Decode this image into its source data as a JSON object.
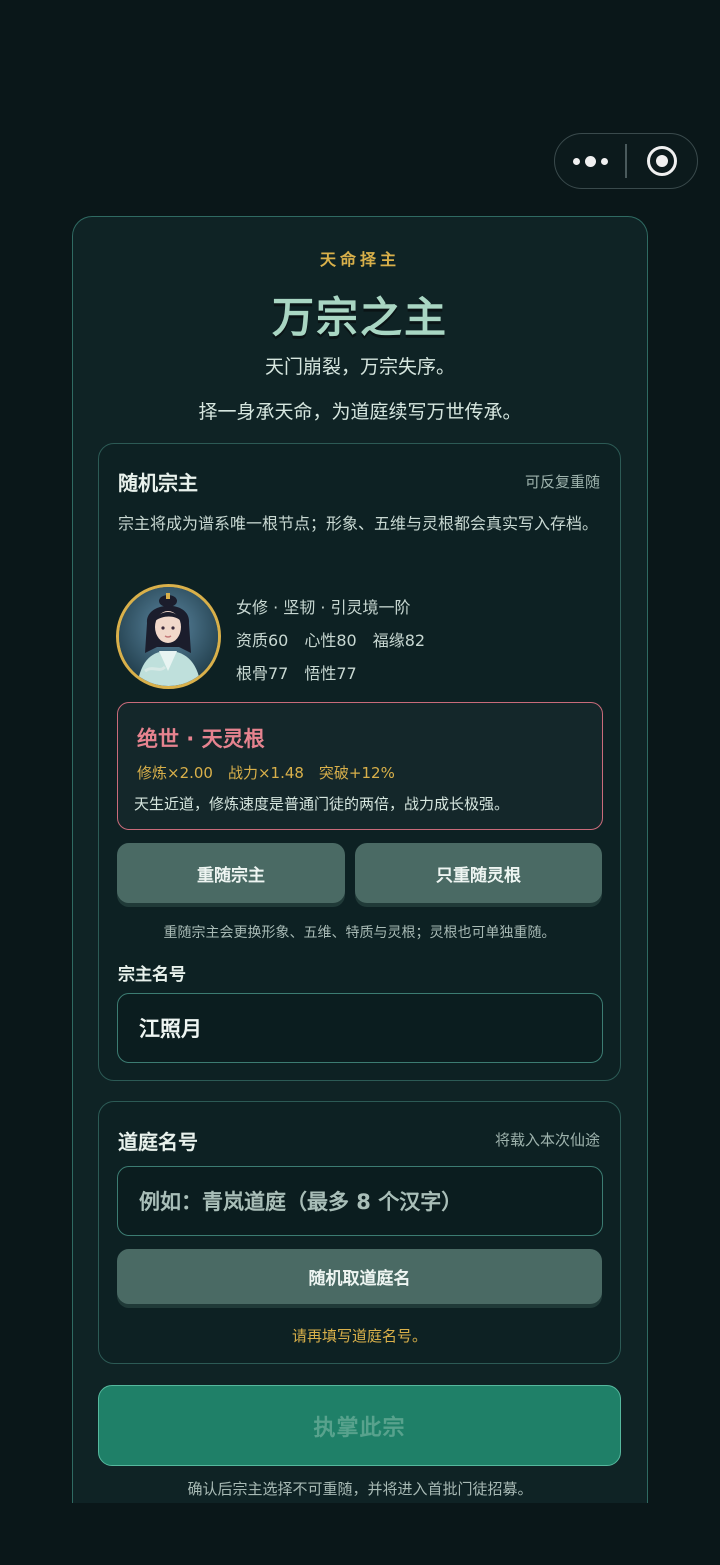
{
  "header": {
    "kicker": "天命择主",
    "title": "万宗之主",
    "subtitle_1": "天门崩裂，万宗失序。",
    "subtitle_2": "择一身承天命，为道庭续写万世传承。"
  },
  "random_master": {
    "heading": "随机宗主",
    "tag": "可反复重随",
    "description": "宗主将成为谱系唯一根节点；形象、五维与灵根都会真实写入存档。",
    "traits_line": "女修 · 坚韧 · 引灵境一阶",
    "stats_line_1": "资质60　心性80　福缘82",
    "stats_line_2": "根骨77　悟性77",
    "spirit_root": {
      "title": "绝世 · 天灵根",
      "modifiers": "修炼×2.00　战力×1.48　突破+12%",
      "description": "天生近道，修炼速度是普通门徒的两倍，战力成长极强。",
      "accent_color": "#e6838f"
    },
    "reroll_master_label": "重随宗主",
    "reroll_root_label": "只重随灵根",
    "hint": "重随宗主会更换形象、五维、特质与灵根；灵根也可单独重随。",
    "name_label": "宗主名号",
    "name_value": "江照月"
  },
  "court": {
    "heading": "道庭名号",
    "tag": "将载入本次仙途",
    "placeholder": "例如：青岚道庭（最多 8 个汉字）",
    "random_name_label": "随机取道庭名",
    "warning": "请再填写道庭名号。"
  },
  "confirm": {
    "label": "执掌此宗",
    "footnote": "确认后宗主选择不可重随，并将进入首批门徒招募。"
  },
  "capsule": {
    "menu_icon": "more-dots-icon",
    "close_icon": "target-circle-icon"
  },
  "colors": {
    "gold": "#d9b04a",
    "accent_green": "#1f8068",
    "background": "#0a1719"
  }
}
